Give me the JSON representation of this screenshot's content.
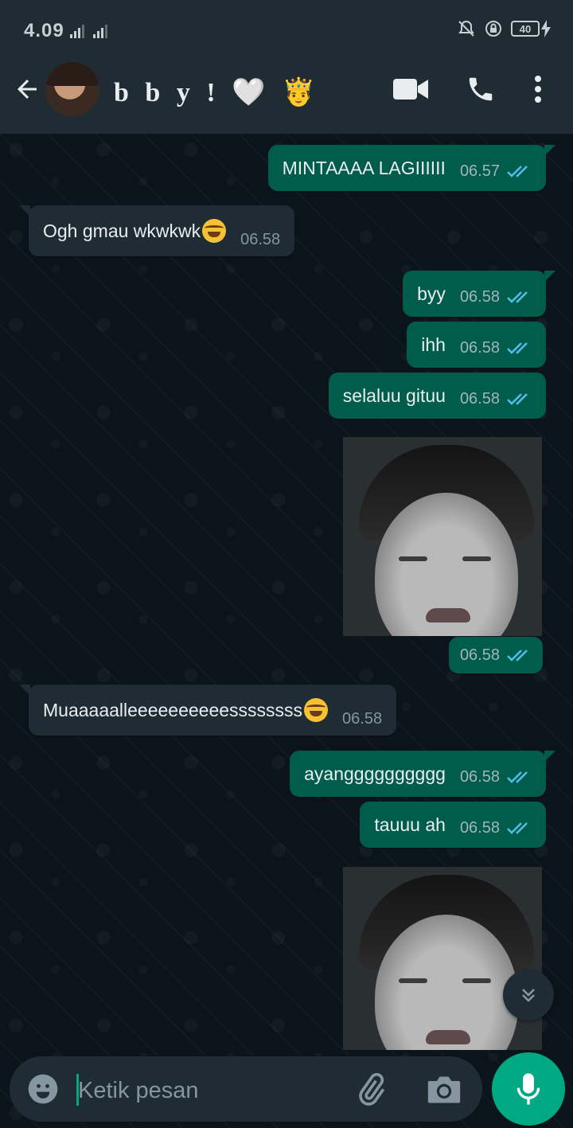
{
  "status_bar": {
    "time": "4.09",
    "battery": "40",
    "icons": [
      "mute-bell-icon",
      "lock-rotation-icon",
      "battery-icon",
      "charging-icon"
    ]
  },
  "header": {
    "contact_name": "b b y ! 🤍 🤴",
    "icons": [
      "back-arrow-icon",
      "video-call-icon",
      "phone-call-icon",
      "more-options-icon"
    ]
  },
  "messages": [
    {
      "direction": "out",
      "text": "MINTAAAA LAGIIIIII",
      "time": "06.57",
      "status": "read"
    },
    {
      "direction": "in",
      "text": "Ogh gmau wkwkwk",
      "emoji": "rolling-on-floor-laughing",
      "time": "06.58"
    },
    {
      "direction": "out",
      "text": "byy",
      "time": "06.58",
      "status": "read"
    },
    {
      "direction": "out",
      "text": "ihh",
      "time": "06.58",
      "status": "read"
    },
    {
      "direction": "out",
      "text": "selaluu gituu",
      "time": "06.58",
      "status": "read"
    },
    {
      "direction": "out",
      "type": "image",
      "time": "06.58",
      "status": "read"
    },
    {
      "direction": "in",
      "text": "Muaaaaalleeeeeeeeeessssssss",
      "emoji": "rolling-on-floor-laughing",
      "time": "06.58"
    },
    {
      "direction": "out",
      "text": "ayangggggggggg",
      "time": "06.58",
      "status": "read"
    },
    {
      "direction": "out",
      "text": "tauuu ah",
      "time": "06.58",
      "status": "read"
    },
    {
      "direction": "out",
      "type": "image"
    }
  ],
  "composer": {
    "placeholder": "Ketik pesan"
  },
  "colors": {
    "outgoing_bubble": "#005c4b",
    "incoming_bubble": "#1f2c33",
    "accent": "#00a884",
    "read_ticks": "#53bdeb",
    "background": "#0b141a"
  }
}
